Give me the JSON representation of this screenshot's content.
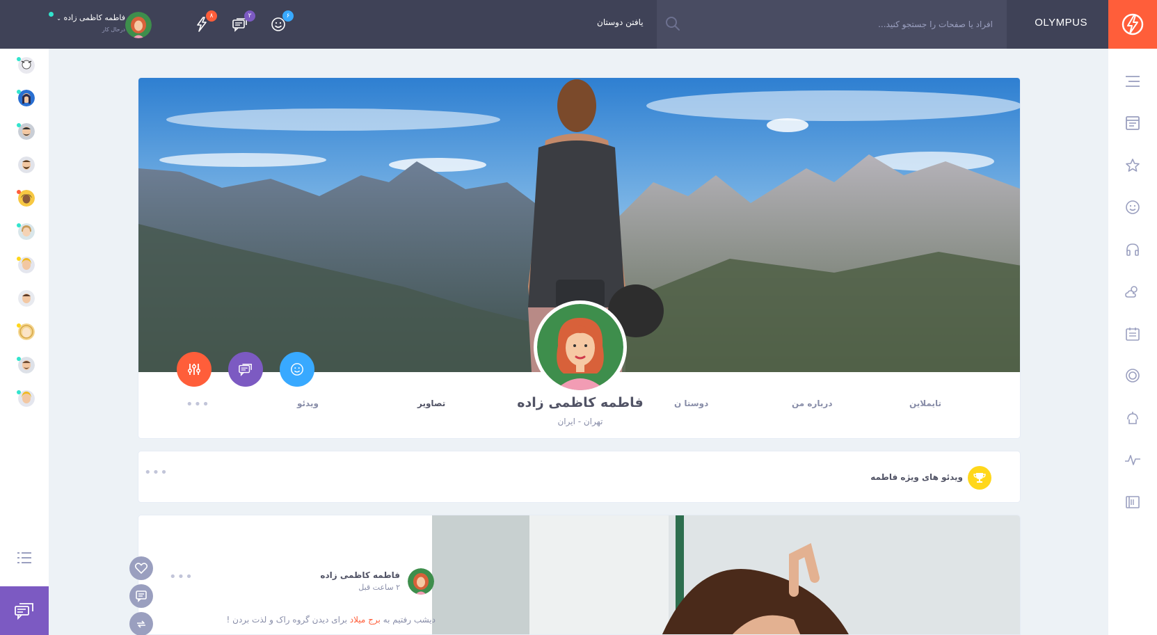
{
  "brand": {
    "name": "OLYMPUS"
  },
  "header": {
    "search_placeholder": "افراد یا صفحات را جستجو کنید...",
    "find_friends": "یافتن دوستان",
    "notifications": [
      {
        "icon": "smiley-icon",
        "count": "۶",
        "color": "#38a9ff"
      },
      {
        "icon": "chat-icon",
        "count": "۲",
        "color": "#7c5ac2"
      },
      {
        "icon": "thunder-icon",
        "count": "۸",
        "color": "#ff5e3a"
      }
    ],
    "user": {
      "name": "فاطمه کاظمی زاده",
      "status": "درحال کار"
    }
  },
  "profile": {
    "name": "فاطمه کاظمی زاده",
    "location": "تهران - ایران",
    "tabs": {
      "timeline": "تایملاین",
      "about": "درباره من",
      "friends": "دوستا ن",
      "photos": "تصاویر",
      "videos": "ویدئو",
      "more": "•••"
    }
  },
  "featured": {
    "title": "ویدئو های ویژه فاطمه",
    "more": "•••"
  },
  "post": {
    "author": "فاطمه کاظمی زاده",
    "time": "۲ ساعت قبل",
    "text_before": "دیشب رفتیم به ",
    "highlight": "برج میلاد",
    "text_after": " برای دیدن گروه راک و لذت بردن !",
    "more": "•••"
  },
  "colors": {
    "header_bg": "#3f4257",
    "accent_orange": "#ff5e3a",
    "accent_purple": "#7c5ac2",
    "accent_blue": "#38a9ff",
    "trophy_yellow": "#ffd71b"
  }
}
